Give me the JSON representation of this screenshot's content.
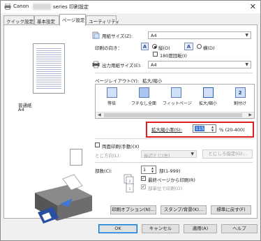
{
  "titlebar": {
    "prefix": "Canon",
    "suffix": "series 印刷設定",
    "close": "✕"
  },
  "tabs": [
    {
      "label": "クイック設定"
    },
    {
      "label": "基本設定"
    },
    {
      "label": "ページ設定"
    },
    {
      "label": "ユーティリティ"
    }
  ],
  "preview": {
    "media": "普通紙",
    "size": "A4"
  },
  "paper_size": {
    "label": "用紙サイズ(Z):",
    "value": "A4"
  },
  "orientation": {
    "label": "印刷の向き：",
    "portrait": "縦(O)",
    "landscape": "横(D)",
    "rotate180": "180度回転(I)"
  },
  "output_size": {
    "label": "出力用紙サイズ(E):",
    "value": "A4"
  },
  "layout": {
    "label": "ページレイアウト(Y):",
    "current": "拡大/縮小",
    "items": [
      {
        "label": "等倍",
        "glyph": ""
      },
      {
        "label": "フチなし全面",
        "glyph": ""
      },
      {
        "label": "フィットページ",
        "glyph": ""
      },
      {
        "label": "拡大/縮小",
        "glyph": ""
      },
      {
        "label": "割付け",
        "glyph": "2"
      }
    ]
  },
  "scaling": {
    "label": "拡大縮小率(S):",
    "value": "115",
    "unit": "％ (20-400)"
  },
  "duplex": {
    "label": "両面印刷(手動)(X)",
    "binding_label": "とじ方向(L):",
    "binding_value": "長辺とじ(左)",
    "margin_button": "とじしろ指定(G)..."
  },
  "copies": {
    "label": "部数(C):",
    "value": "1",
    "range": "部(1-999)",
    "reverse": "最終ページから印刷(R)",
    "collate": "部単位で印刷(O)"
  },
  "bottom_buttons": {
    "print_options": "印刷オプション(N)...",
    "stamp": "スタンプ/背景(K)...",
    "defaults": "標準に戻す(F)"
  },
  "dialog": {
    "ok": "OK",
    "cancel": "キャンセル",
    "apply": "適用(A)",
    "help": "ヘルプ"
  },
  "colors": {
    "accent": "#0078d7",
    "highlight": "#e02020",
    "selection": "#3a78d8"
  }
}
